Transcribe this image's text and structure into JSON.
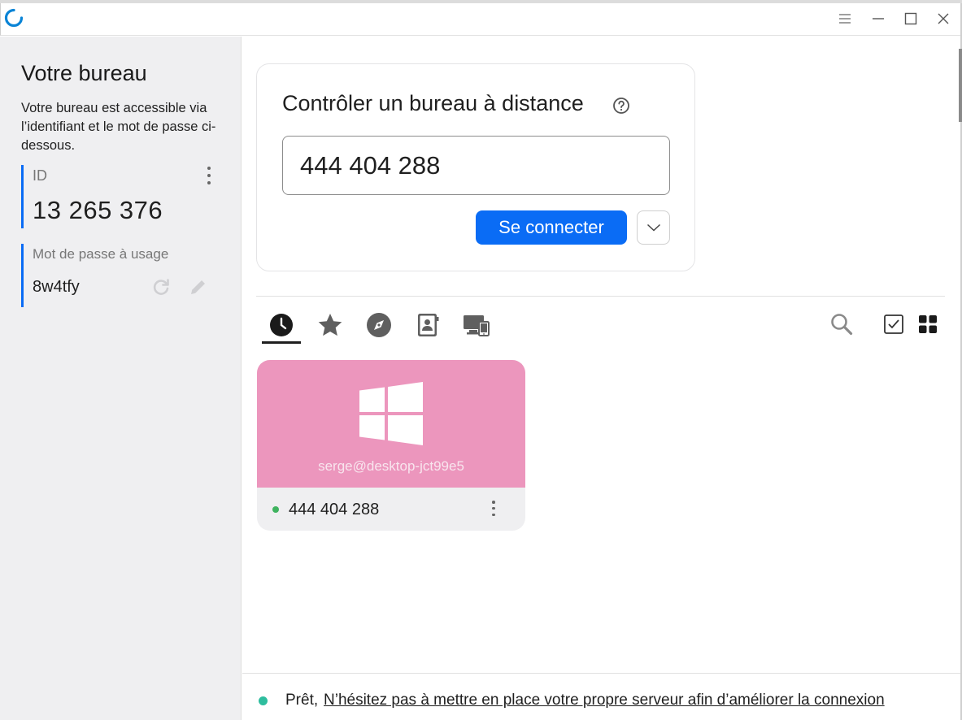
{
  "window": {
    "controls": [
      "menu-icon",
      "minimize-icon",
      "maximize-icon",
      "close-icon"
    ]
  },
  "sidebar": {
    "title": "Votre bureau",
    "description": "Votre bureau est accessible via l’identifiant et le mot de passe ci-dessous.",
    "id_label": "ID",
    "id_value": "13 265 376",
    "password_label": "Mot de passe à usage",
    "password_value": "8w4tfy"
  },
  "connect": {
    "title": "Contrôler un bureau à distance",
    "input_value": "444 404 288",
    "button_label": "Se connecter"
  },
  "tabs": [
    {
      "icon": "history-icon",
      "active": true
    },
    {
      "icon": "star-icon",
      "active": false
    },
    {
      "icon": "compass-icon",
      "active": false
    },
    {
      "icon": "address-book-icon",
      "active": false
    },
    {
      "icon": "devices-icon",
      "active": false
    }
  ],
  "tools": [
    "search-icon",
    "checkbox-icon",
    "grid-view-icon"
  ],
  "peers": [
    {
      "user": "serge@desktop-jct99e5",
      "id": "444 404 288",
      "online": true,
      "os": "windows-icon",
      "thumb_color": "#ec96bd"
    }
  ],
  "status": {
    "ready": "Prêt,",
    "link": "N’hésitez pas à mettre en place votre propre serveur afin d’améliorer la connexion"
  },
  "colors": {
    "accent": "#0a6cf5",
    "status_ok": "#2ebd9e",
    "online": "#3fb35f"
  }
}
